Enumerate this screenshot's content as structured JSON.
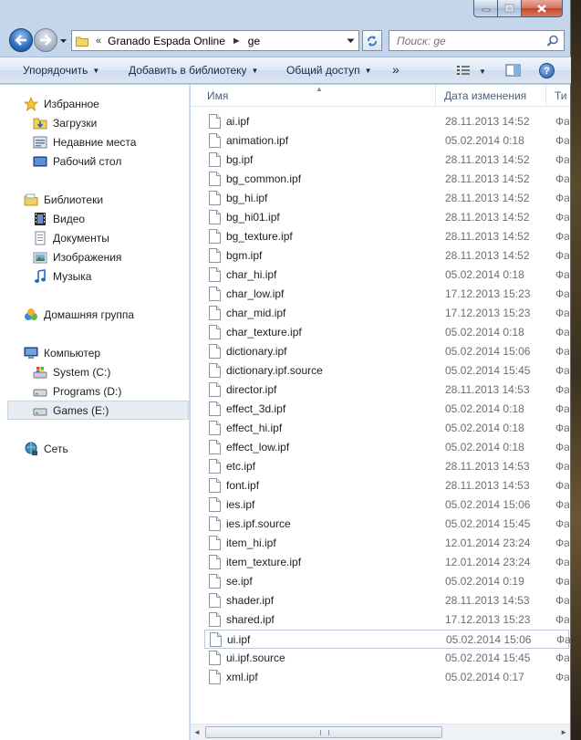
{
  "window": {
    "caption_buttons": [
      "minimize-icon",
      "maximize-icon",
      "close-icon"
    ]
  },
  "address": {
    "overflow": "«",
    "segments": [
      "Granado Espada Online",
      "ge"
    ],
    "separator": "►"
  },
  "search": {
    "placeholder": "Поиск: ge"
  },
  "commands": {
    "organize": "Упорядочить",
    "add_library": "Добавить в библиотеку",
    "share": "Общий доступ",
    "more": "»"
  },
  "nav": {
    "favorites": "Избранное",
    "downloads": "Загрузки",
    "recent": "Недавние места",
    "desktop": "Рабочий стол",
    "libraries": "Библиотеки",
    "video": "Видео",
    "documents": "Документы",
    "pictures": "Изображения",
    "music": "Музыка",
    "homegroup": "Домашняя группа",
    "computer": "Компьютер",
    "drive_c": "System (C:)",
    "drive_d": "Programs (D:)",
    "drive_e": "Games (E:)",
    "network": "Сеть"
  },
  "columns": {
    "name": "Имя",
    "date": "Дата изменения",
    "type": "Ти"
  },
  "files": [
    {
      "name": "ai.ipf",
      "date": "28.11.2013 14:52",
      "type": "Фа"
    },
    {
      "name": "animation.ipf",
      "date": "05.02.2014 0:18",
      "type": "Фа"
    },
    {
      "name": "bg.ipf",
      "date": "28.11.2013 14:52",
      "type": "Фа"
    },
    {
      "name": "bg_common.ipf",
      "date": "28.11.2013 14:52",
      "type": "Фа"
    },
    {
      "name": "bg_hi.ipf",
      "date": "28.11.2013 14:52",
      "type": "Фа"
    },
    {
      "name": "bg_hi01.ipf",
      "date": "28.11.2013 14:52",
      "type": "Фа"
    },
    {
      "name": "bg_texture.ipf",
      "date": "28.11.2013 14:52",
      "type": "Фа"
    },
    {
      "name": "bgm.ipf",
      "date": "28.11.2013 14:52",
      "type": "Фа"
    },
    {
      "name": "char_hi.ipf",
      "date": "05.02.2014 0:18",
      "type": "Фа"
    },
    {
      "name": "char_low.ipf",
      "date": "17.12.2013 15:23",
      "type": "Фа"
    },
    {
      "name": "char_mid.ipf",
      "date": "17.12.2013 15:23",
      "type": "Фа"
    },
    {
      "name": "char_texture.ipf",
      "date": "05.02.2014 0:18",
      "type": "Фа"
    },
    {
      "name": "dictionary.ipf",
      "date": "05.02.2014 15:06",
      "type": "Фа"
    },
    {
      "name": "dictionary.ipf.source",
      "date": "05.02.2014 15:45",
      "type": "Фа"
    },
    {
      "name": "director.ipf",
      "date": "28.11.2013 14:53",
      "type": "Фа"
    },
    {
      "name": "effect_3d.ipf",
      "date": "05.02.2014 0:18",
      "type": "Фа"
    },
    {
      "name": "effect_hi.ipf",
      "date": "05.02.2014 0:18",
      "type": "Фа"
    },
    {
      "name": "effect_low.ipf",
      "date": "05.02.2014 0:18",
      "type": "Фа"
    },
    {
      "name": "etc.ipf",
      "date": "28.11.2013 14:53",
      "type": "Фа"
    },
    {
      "name": "font.ipf",
      "date": "28.11.2013 14:53",
      "type": "Фа"
    },
    {
      "name": "ies.ipf",
      "date": "05.02.2014 15:06",
      "type": "Фа"
    },
    {
      "name": "ies.ipf.source",
      "date": "05.02.2014 15:45",
      "type": "Фа"
    },
    {
      "name": "item_hi.ipf",
      "date": "12.01.2014 23:24",
      "type": "Фа"
    },
    {
      "name": "item_texture.ipf",
      "date": "12.01.2014 23:24",
      "type": "Фа"
    },
    {
      "name": "se.ipf",
      "date": "05.02.2014 0:19",
      "type": "Фа"
    },
    {
      "name": "shader.ipf",
      "date": "28.11.2013 14:53",
      "type": "Фа"
    },
    {
      "name": "shared.ipf",
      "date": "17.12.2013 15:23",
      "type": "Фа"
    },
    {
      "name": "ui.ipf",
      "date": "05.02.2014 15:06",
      "type": "Фа"
    },
    {
      "name": "ui.ipf.source",
      "date": "05.02.2014 15:45",
      "type": "Фа"
    },
    {
      "name": "xml.ipf",
      "date": "05.02.2014 0:17",
      "type": "Фа"
    }
  ],
  "selected_file": "ui.ipf",
  "selected_nav": "Games (E:)"
}
